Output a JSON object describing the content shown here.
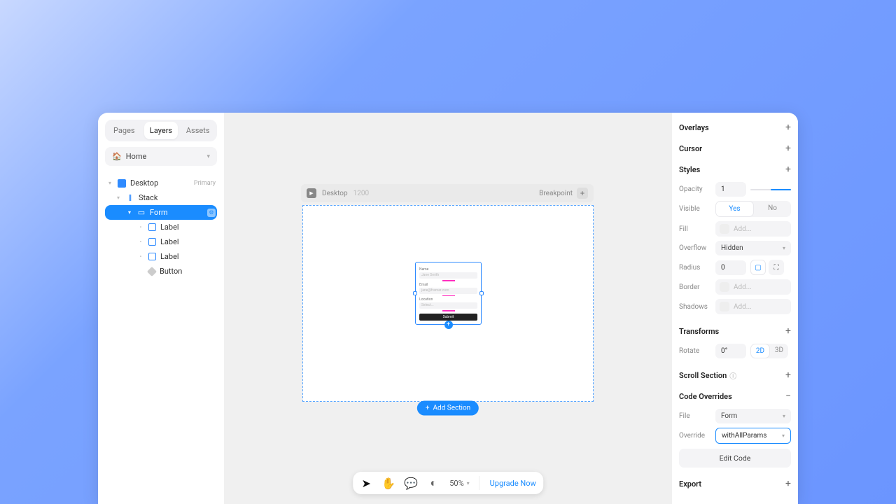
{
  "sidebar": {
    "tabs": [
      "Pages",
      "Layers",
      "Assets"
    ],
    "active_tab": 1,
    "home_label": "Home",
    "layers": {
      "desktop": {
        "label": "Desktop",
        "tag": "Primary"
      },
      "stack": {
        "label": "Stack"
      },
      "form": {
        "label": "Form"
      },
      "labels": [
        "Label",
        "Label",
        "Label"
      ],
      "button": {
        "label": "Button"
      }
    }
  },
  "canvas": {
    "breakpoint": {
      "name": "Desktop",
      "width": "1200",
      "label": "Breakpoint"
    },
    "form": {
      "name_label": "Name",
      "name_placeholder": "Jane Smith",
      "email_label": "Email",
      "email_placeholder": "jane@framer.com",
      "location_label": "Location",
      "location_placeholder": "Select...",
      "submit": "Submit"
    },
    "add_section": "Add Section"
  },
  "toolbar": {
    "zoom": "50%",
    "upgrade": "Upgrade Now"
  },
  "inspector": {
    "overlays": "Overlays",
    "cursor": "Cursor",
    "styles": {
      "header": "Styles",
      "opacity_label": "Opacity",
      "opacity_value": "1",
      "visible_label": "Visible",
      "visible_yes": "Yes",
      "visible_no": "No",
      "fill_label": "Fill",
      "fill_add": "Add...",
      "overflow_label": "Overflow",
      "overflow_value": "Hidden",
      "radius_label": "Radius",
      "radius_value": "0",
      "border_label": "Border",
      "border_add": "Add...",
      "shadows_label": "Shadows",
      "shadows_add": "Add..."
    },
    "transforms": {
      "header": "Transforms",
      "rotate_label": "Rotate",
      "rotate_value": "0°",
      "mode_2d": "2D",
      "mode_3d": "3D"
    },
    "scroll_section": "Scroll Section",
    "code_overrides": {
      "header": "Code Overrides",
      "file_label": "File",
      "file_value": "Form",
      "override_label": "Override",
      "override_value": "withAllParams",
      "edit": "Edit Code"
    },
    "export": "Export"
  }
}
